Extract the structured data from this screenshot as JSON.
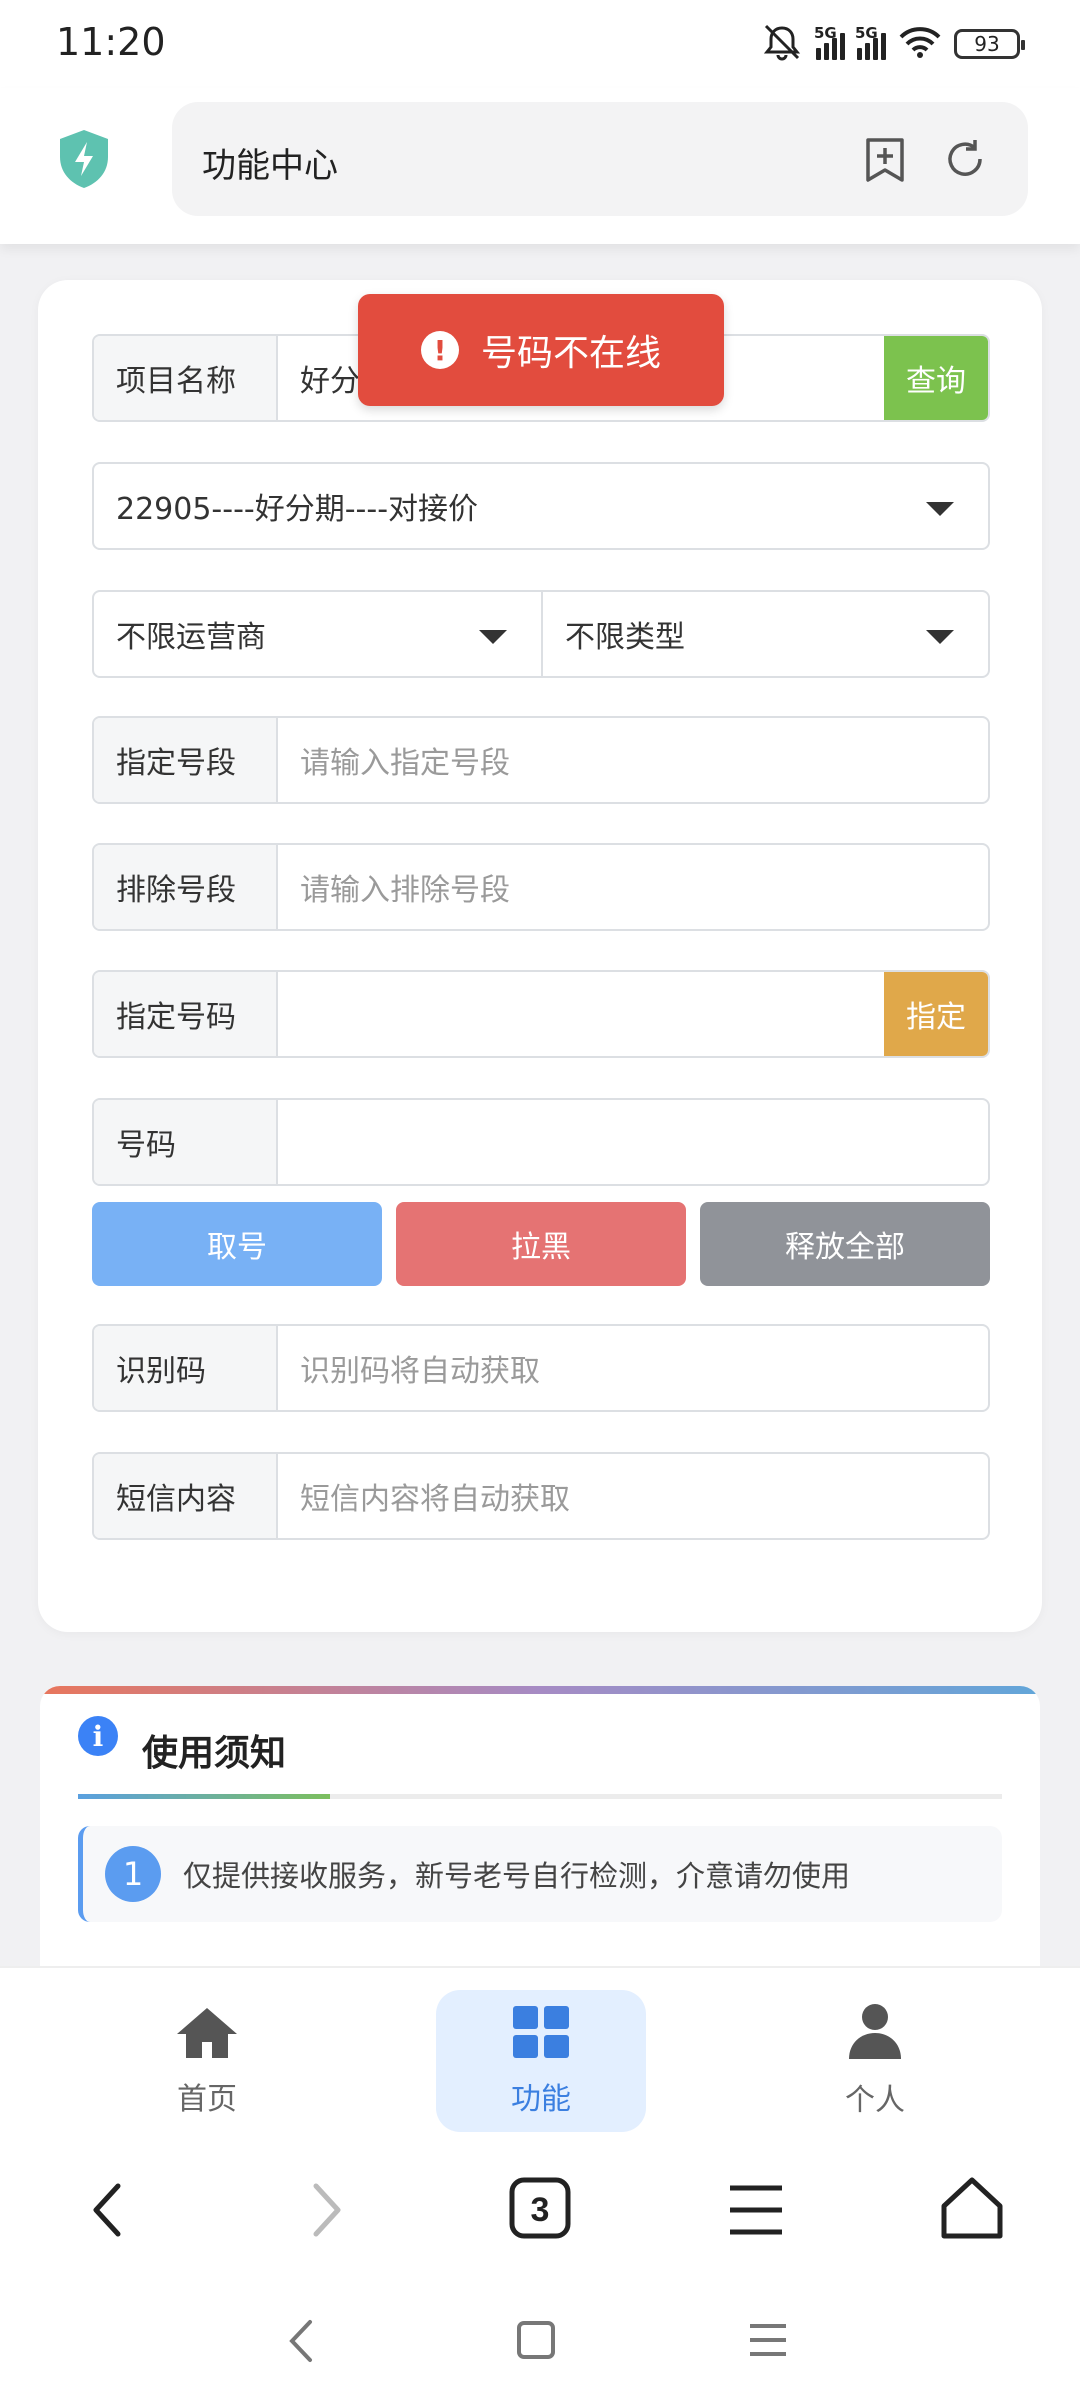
{
  "status": {
    "time": "11:20",
    "battery": "93",
    "net1": "5G",
    "net2": "5G"
  },
  "address": {
    "title": "功能中心"
  },
  "form": {
    "project_label": "项目名称",
    "project_value": "好分",
    "query_button": "查询",
    "project_select": "22905----好分期----对接价",
    "carrier_select": "不限运营商",
    "type_select": "不限类型",
    "segment_label": "指定号段",
    "segment_placeholder": "请输入指定号段",
    "exclude_label": "排除号段",
    "exclude_placeholder": "请输入排除号段",
    "number_spec_label": "指定号码",
    "number_spec_button": "指定",
    "number_label": "号码",
    "get_button": "取号",
    "block_button": "拉黑",
    "release_button": "释放全部",
    "code_label": "识别码",
    "code_placeholder": "识别码将自动获取",
    "sms_label": "短信内容",
    "sms_placeholder": "短信内容将自动获取"
  },
  "toast": {
    "message": "号码不在线"
  },
  "notice": {
    "title": "使用须知",
    "items": [
      {
        "num": "1",
        "text": "仅提供接收服务，新号老号自行检测，介意请勿使用"
      }
    ]
  },
  "tabs": [
    {
      "label": "首页",
      "icon": "home-icon"
    },
    {
      "label": "功能",
      "icon": "grid-icon",
      "active": true
    },
    {
      "label": "个人",
      "icon": "person-icon"
    }
  ],
  "browser": {
    "tab_count": "3"
  },
  "colors": {
    "query": "#7cc24e",
    "specify": "#e0a84a",
    "get": "#78b1f5",
    "block": "#e57373",
    "release": "#909399",
    "toast": "#e24c3e",
    "active_tab": "#3b7fe0"
  }
}
